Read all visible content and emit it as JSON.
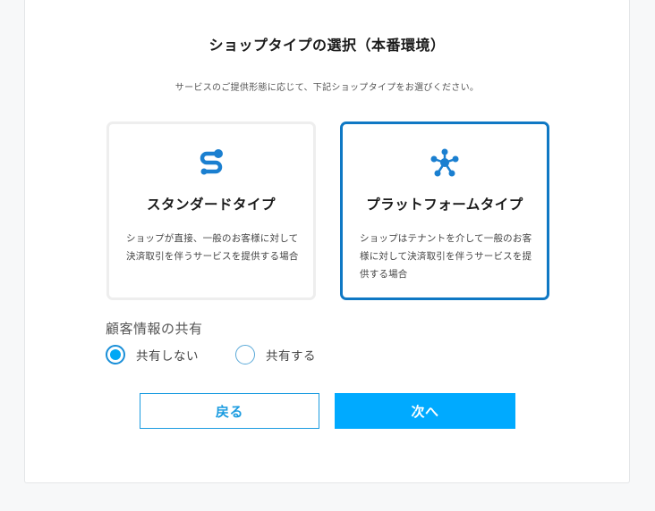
{
  "page": {
    "title": "ショップタイプの選択（本番環境）",
    "subtitle": "サービスのご提供形態に応じて、下記ショップタイプをお選びください。"
  },
  "cards": [
    {
      "title": "スタンダードタイプ",
      "description": "ショップが直接、一般のお客様に対して決済取引を伴うサービスを提供する場合",
      "icon": "standard-route-icon",
      "selected": false
    },
    {
      "title": "プラットフォームタイプ",
      "description": "ショップはテナントを介して一般のお客様に対して決済取引を伴うサービスを提供する場合",
      "icon": "platform-network-icon",
      "selected": true
    }
  ],
  "share": {
    "label": "顧客情報の共有",
    "options": [
      {
        "label": "共有しない",
        "checked": true
      },
      {
        "label": "共有する",
        "checked": false
      }
    ]
  },
  "buttons": {
    "back": "戻る",
    "next": "次へ"
  },
  "colors": {
    "accent": "#00aaff",
    "selected_border": "#0f78c4",
    "icon": "#1a7fd0"
  }
}
